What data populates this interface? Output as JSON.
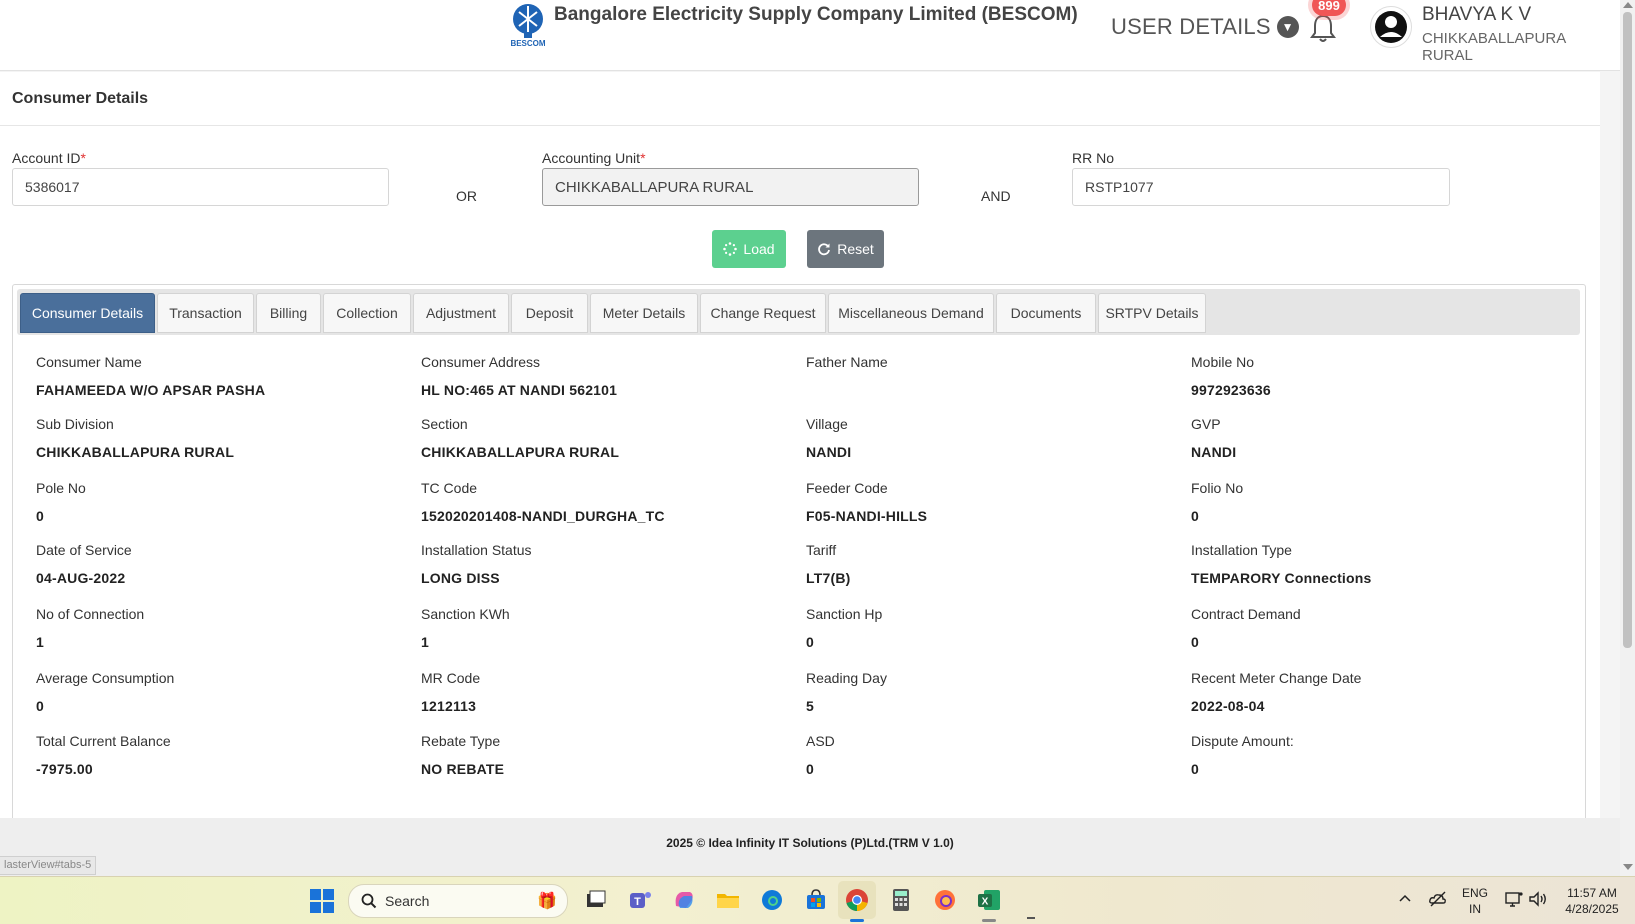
{
  "header": {
    "company_name": "Bangalore Electricity Supply Company Limited (BESCOM)",
    "logo_text": "BESCOM",
    "user_details_label": "USER DETAILS",
    "notification_count": "899",
    "user_name": "BHAVYA K V",
    "user_unit": "CHIKKABALLAPURA RURAL"
  },
  "panel": {
    "title": "Consumer Details"
  },
  "search": {
    "account_id_label": "Account ID",
    "account_id_value": "5386017",
    "or_label": "OR",
    "accounting_unit_label": "Accounting Unit",
    "accounting_unit_value": "CHIKKABALLAPURA RURAL",
    "and_label": "AND",
    "rr_no_label": "RR No",
    "rr_no_value": "RSTP1077",
    "required_mark": "*",
    "load_label": "Load",
    "reset_label": "Reset"
  },
  "tabs": [
    {
      "label": "Consumer Details",
      "active": true
    },
    {
      "label": "Transaction",
      "active": false
    },
    {
      "label": "Billing",
      "active": false
    },
    {
      "label": "Collection",
      "active": false
    },
    {
      "label": "Adjustment",
      "active": false
    },
    {
      "label": "Deposit",
      "active": false
    },
    {
      "label": "Meter Details",
      "active": false
    },
    {
      "label": "Change Request",
      "active": false
    },
    {
      "label": "Miscellaneous Demand",
      "active": false
    },
    {
      "label": "Documents",
      "active": false
    },
    {
      "label": "SRTPV Details",
      "active": false
    }
  ],
  "details": [
    [
      {
        "label": "Consumer Name",
        "value": "FAHAMEEDA W/O APSAR PASHA"
      },
      {
        "label": "Consumer Address",
        "value": "HL NO:465 AT NANDI 562101"
      },
      {
        "label": "Father Name",
        "value": ""
      },
      {
        "label": "Mobile No",
        "value": "9972923636"
      }
    ],
    [
      {
        "label": "Sub Division",
        "value": "CHIKKABALLAPURA RURAL"
      },
      {
        "label": "Section",
        "value": "CHIKKABALLAPURA RURAL"
      },
      {
        "label": "Village",
        "value": "NANDI"
      },
      {
        "label": "GVP",
        "value": "NANDI"
      }
    ],
    [
      {
        "label": "Pole No",
        "value": "0"
      },
      {
        "label": "TC Code",
        "value": "152020201408-NANDI_DURGHA_TC"
      },
      {
        "label": "Feeder Code",
        "value": "F05-NANDI-HILLS"
      },
      {
        "label": "Folio No",
        "value": "0"
      }
    ],
    [
      {
        "label": "Date of Service",
        "value": "04-AUG-2022"
      },
      {
        "label": "Installation Status",
        "value": "LONG DISS"
      },
      {
        "label": "Tariff",
        "value": "LT7(B)"
      },
      {
        "label": "Installation Type",
        "value": "TEMPARORY Connections"
      }
    ],
    [
      {
        "label": "No of Connection",
        "value": "1"
      },
      {
        "label": "Sanction KWh",
        "value": "1"
      },
      {
        "label": "Sanction Hp",
        "value": "0"
      },
      {
        "label": "Contract Demand",
        "value": "0"
      }
    ],
    [
      {
        "label": "Average Consumption",
        "value": "0"
      },
      {
        "label": "MR Code",
        "value": "1212113"
      },
      {
        "label": "Reading Day",
        "value": "5"
      },
      {
        "label": "Recent Meter Change Date",
        "value": "2022-08-04"
      }
    ],
    [
      {
        "label": "Total Current Balance",
        "value": "-7975.00"
      },
      {
        "label": "Rebate Type",
        "value": "NO REBATE"
      },
      {
        "label": "ASD",
        "value": "0"
      },
      {
        "label": "Dispute Amount:",
        "value": "0"
      }
    ]
  ],
  "footer": {
    "text": "2025 © Idea Infinity IT Solutions (P)Ltd.(TRM V 1.0)",
    "status_url": "lasterView#tabs-5"
  },
  "taskbar": {
    "search_label": "Search",
    "lang_top": "ENG",
    "lang_bottom": "IN",
    "time": "11:57 AM",
    "date": "4/28/2025",
    "colors": {
      "excel": "#1e7145",
      "edge": "#0f7ad8",
      "chrome_red": "#db4437"
    }
  }
}
